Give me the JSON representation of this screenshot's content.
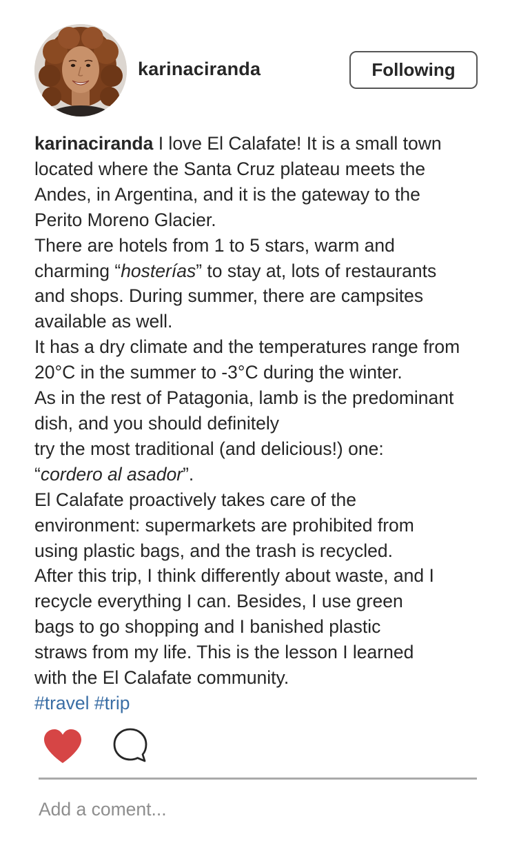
{
  "post": {
    "username": "karinaciranda",
    "follow_label": "Following",
    "caption": {
      "author": "karinaciranda",
      "line1_rest": " I love El Calafate! It is a small town",
      "line2": "located where the Santa Cruz plateau meets the",
      "line3": "Andes, in Argentina, and it is the gateway to the",
      "line4": "Perito Moreno Glacier.",
      "line5": "There are hotels from 1 to 5 stars, warm and",
      "line6_pre": "charming “",
      "line6_em": "hosterías",
      "line6_post": "” to stay at, lots of restaurants",
      "line7": "and shops. During summer, there are campsites",
      "line8": "available as well.",
      "line9": "It has a dry climate and the temperatures range from",
      "line10": "20°C in the summer to -3°C during the winter.",
      "line11": "As in the rest of Patagonia, lamb is the predominant",
      "line12": "dish, and you should definitely",
      "line13": "try the most traditional (and delicious!) one:",
      "line14_pre": "“",
      "line14_em": "cordero al asador",
      "line14_post": "”.",
      "line15": "El Calafate proactively takes care of the",
      "line16": "environment: supermarkets are prohibited from",
      "line17": "using plastic bags, and the trash is recycled.",
      "line18": "After this trip, I think differently about waste, and I",
      "line19": "recycle everything I can. Besides, I use green",
      "line20": "bags to go shopping and I banished plastic",
      "line21": "straws from my life. This is the lesson I learned",
      "line22": "with the El Calafate community."
    },
    "hashtags": [
      "#travel",
      "#trip"
    ],
    "actions": {
      "like_icon": "heart-icon",
      "like_color": "#d64545",
      "comment_icon": "comment-bubble-icon"
    },
    "comment_placeholder": "Add a coment..."
  },
  "colors": {
    "text": "#262626",
    "hashtag": "#3a6ea5",
    "heart": "#d64545",
    "divider": "#a9a9a9",
    "placeholder": "#8e8e8e"
  }
}
